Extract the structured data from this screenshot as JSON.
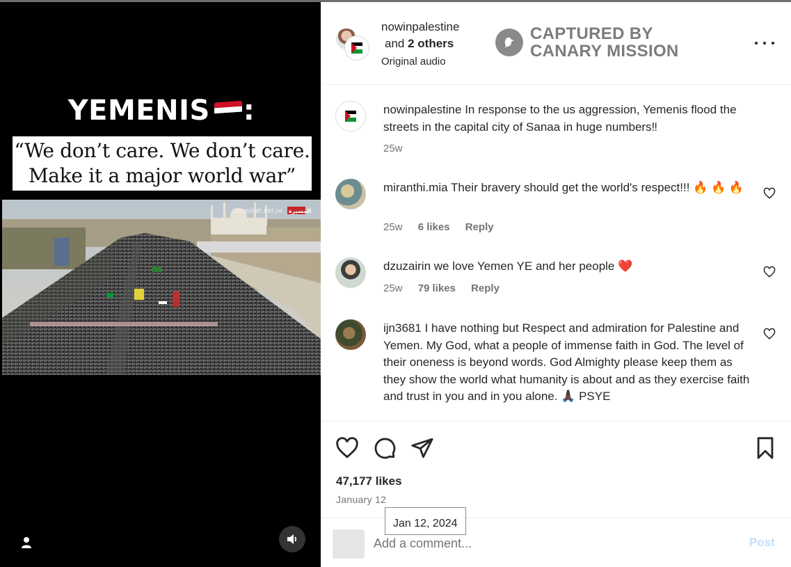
{
  "media": {
    "headline": "YEMENIS",
    "headline_suffix": ":",
    "quote_line1": "“We don’t care. We don’t care.",
    "quote_line2": "Make it a major world war”",
    "watermark": "almasirah.net.ye",
    "watermark_logo": "المسيرة",
    "profile_icon": "user-icon",
    "audio_icon": "speaker-icon"
  },
  "header": {
    "username": "nowinpalestine",
    "others_prefix": "and",
    "others_count": "2 others",
    "audio": "Original audio",
    "captured_line1": "CAPTURED BY",
    "captured_line2": "CANARY MISSION",
    "more_icon": "more-icon"
  },
  "caption": {
    "username": "nowinpalestine",
    "text": "In response to the us aggression, Yemenis flood the streets in the capital city of Sanaa in huge numbers‼",
    "time": "25w"
  },
  "comments": [
    {
      "username": "miranthi.mia",
      "text": "Their bravery should get the world's respect!!! 🔥 🔥 🔥",
      "time": "25w",
      "likes": "6 likes",
      "reply": "Reply"
    },
    {
      "username": "dzuzairin",
      "text": "we love Yemen YE and her people ❤️",
      "time": "25w",
      "likes": "79 likes",
      "reply": "Reply"
    },
    {
      "username": "ijn3681",
      "text": "I have nothing but Respect and admiration for Palestine and Yemen. My God, what a people of immense faith in God. The level of their oneness is beyond words. God Almighty please keep them as they show the world what humanity is about and as they exercise faith and trust in you and in you alone. 🙏🏿 PSYE"
    }
  ],
  "actions": {
    "likes": "47,177 likes",
    "date": "January 12",
    "tooltip": "Jan 12, 2024"
  },
  "comment_box": {
    "placeholder": "Add a comment...",
    "post_label": "Post"
  },
  "colors": {
    "accent_disabled": "#c0dffd",
    "flag_red": "#ce1126",
    "flag_green": "#009736"
  }
}
